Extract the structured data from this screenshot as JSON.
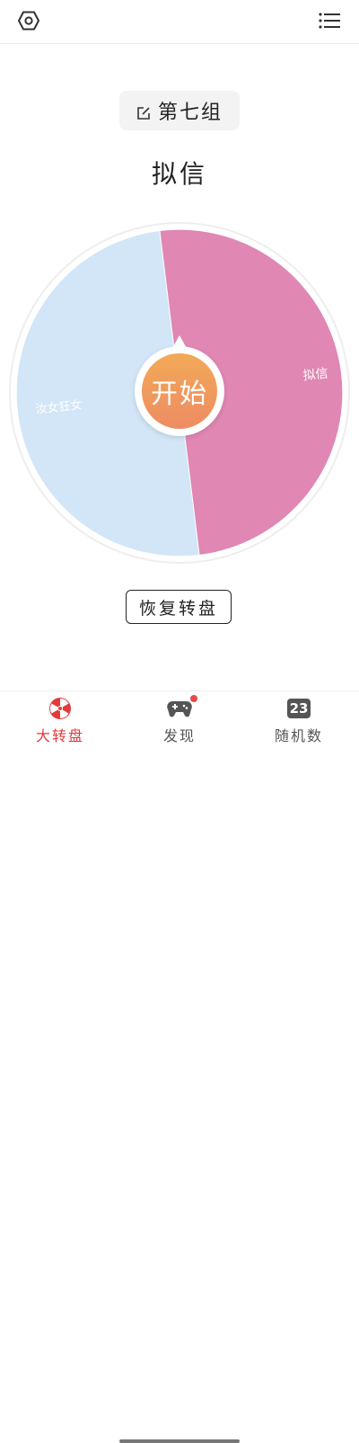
{
  "header": {
    "left_icon": "settings-hexagon-icon",
    "right_icon": "list-menu-icon"
  },
  "group": {
    "label": "第七组",
    "icon": "edit-icon"
  },
  "result": {
    "text": "拟信"
  },
  "wheel": {
    "segments": [
      {
        "label": "拟信",
        "color": "#e087b4"
      },
      {
        "label": "汝女狂女",
        "color": "#d2e6f7"
      }
    ],
    "start_label": "开始",
    "start_gradient": [
      "#f2a958",
      "#ee8c63"
    ]
  },
  "restore_button": {
    "label": "恢复转盘"
  },
  "tabs": [
    {
      "label": "大转盘",
      "icon": "wheel-icon",
      "active": true
    },
    {
      "label": "发现",
      "icon": "gamepad-icon",
      "active": false,
      "badge": true
    },
    {
      "label": "随机数",
      "icon": "number-icon",
      "icon_text": "23",
      "active": false
    }
  ],
  "colors": {
    "accent": "#e23b3b",
    "pink": "#e087b4",
    "blue": "#d2e6f7"
  }
}
